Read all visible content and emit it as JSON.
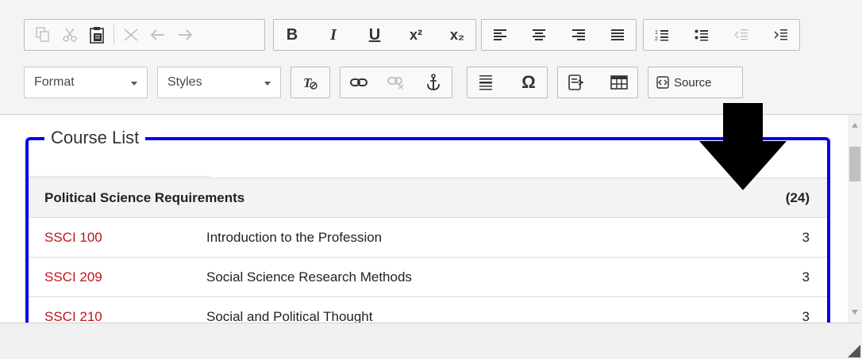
{
  "toolbar": {
    "row1": {
      "clipboard": [
        {
          "name": "copy-icon",
          "glyph": "⧉",
          "enabled": false
        },
        {
          "name": "cut-icon",
          "glyph": "✂",
          "enabled": false
        },
        {
          "name": "paste-icon",
          "glyph": "📋",
          "enabled": true
        },
        {
          "name": "remove-icon",
          "glyph": "✕",
          "enabled": false
        },
        {
          "name": "undo-icon",
          "glyph": "⇽",
          "enabled": false
        },
        {
          "name": "redo-icon",
          "glyph": "⇾",
          "enabled": false
        }
      ],
      "basic_styles": {
        "bold": "B",
        "italic": "I",
        "underline": "U",
        "superscript": "x²",
        "subscript": "x₂"
      },
      "align": [
        "left",
        "center",
        "right",
        "justify"
      ],
      "lists": [
        "numbered-list",
        "bulleted-list",
        "decrease-indent",
        "increase-indent"
      ]
    },
    "row2": {
      "format_label": "Format",
      "styles_label": "Styles",
      "source_label": "Source"
    }
  },
  "legend": "Course List",
  "table": {
    "header": {
      "title": "Political Science Requirements",
      "credits": "(24)"
    },
    "rows": [
      {
        "code": "SSCI 100",
        "title": "Introduction to the Profession",
        "credits": "3"
      },
      {
        "code": "SSCI 209",
        "title": "Social Science Research Methods",
        "credits": "3"
      },
      {
        "code": "SSCI 210",
        "title": "Social and Political Thought",
        "credits": "3"
      }
    ]
  },
  "colors": {
    "border_accent": "#0000ee",
    "course_code": "#c0141c"
  }
}
